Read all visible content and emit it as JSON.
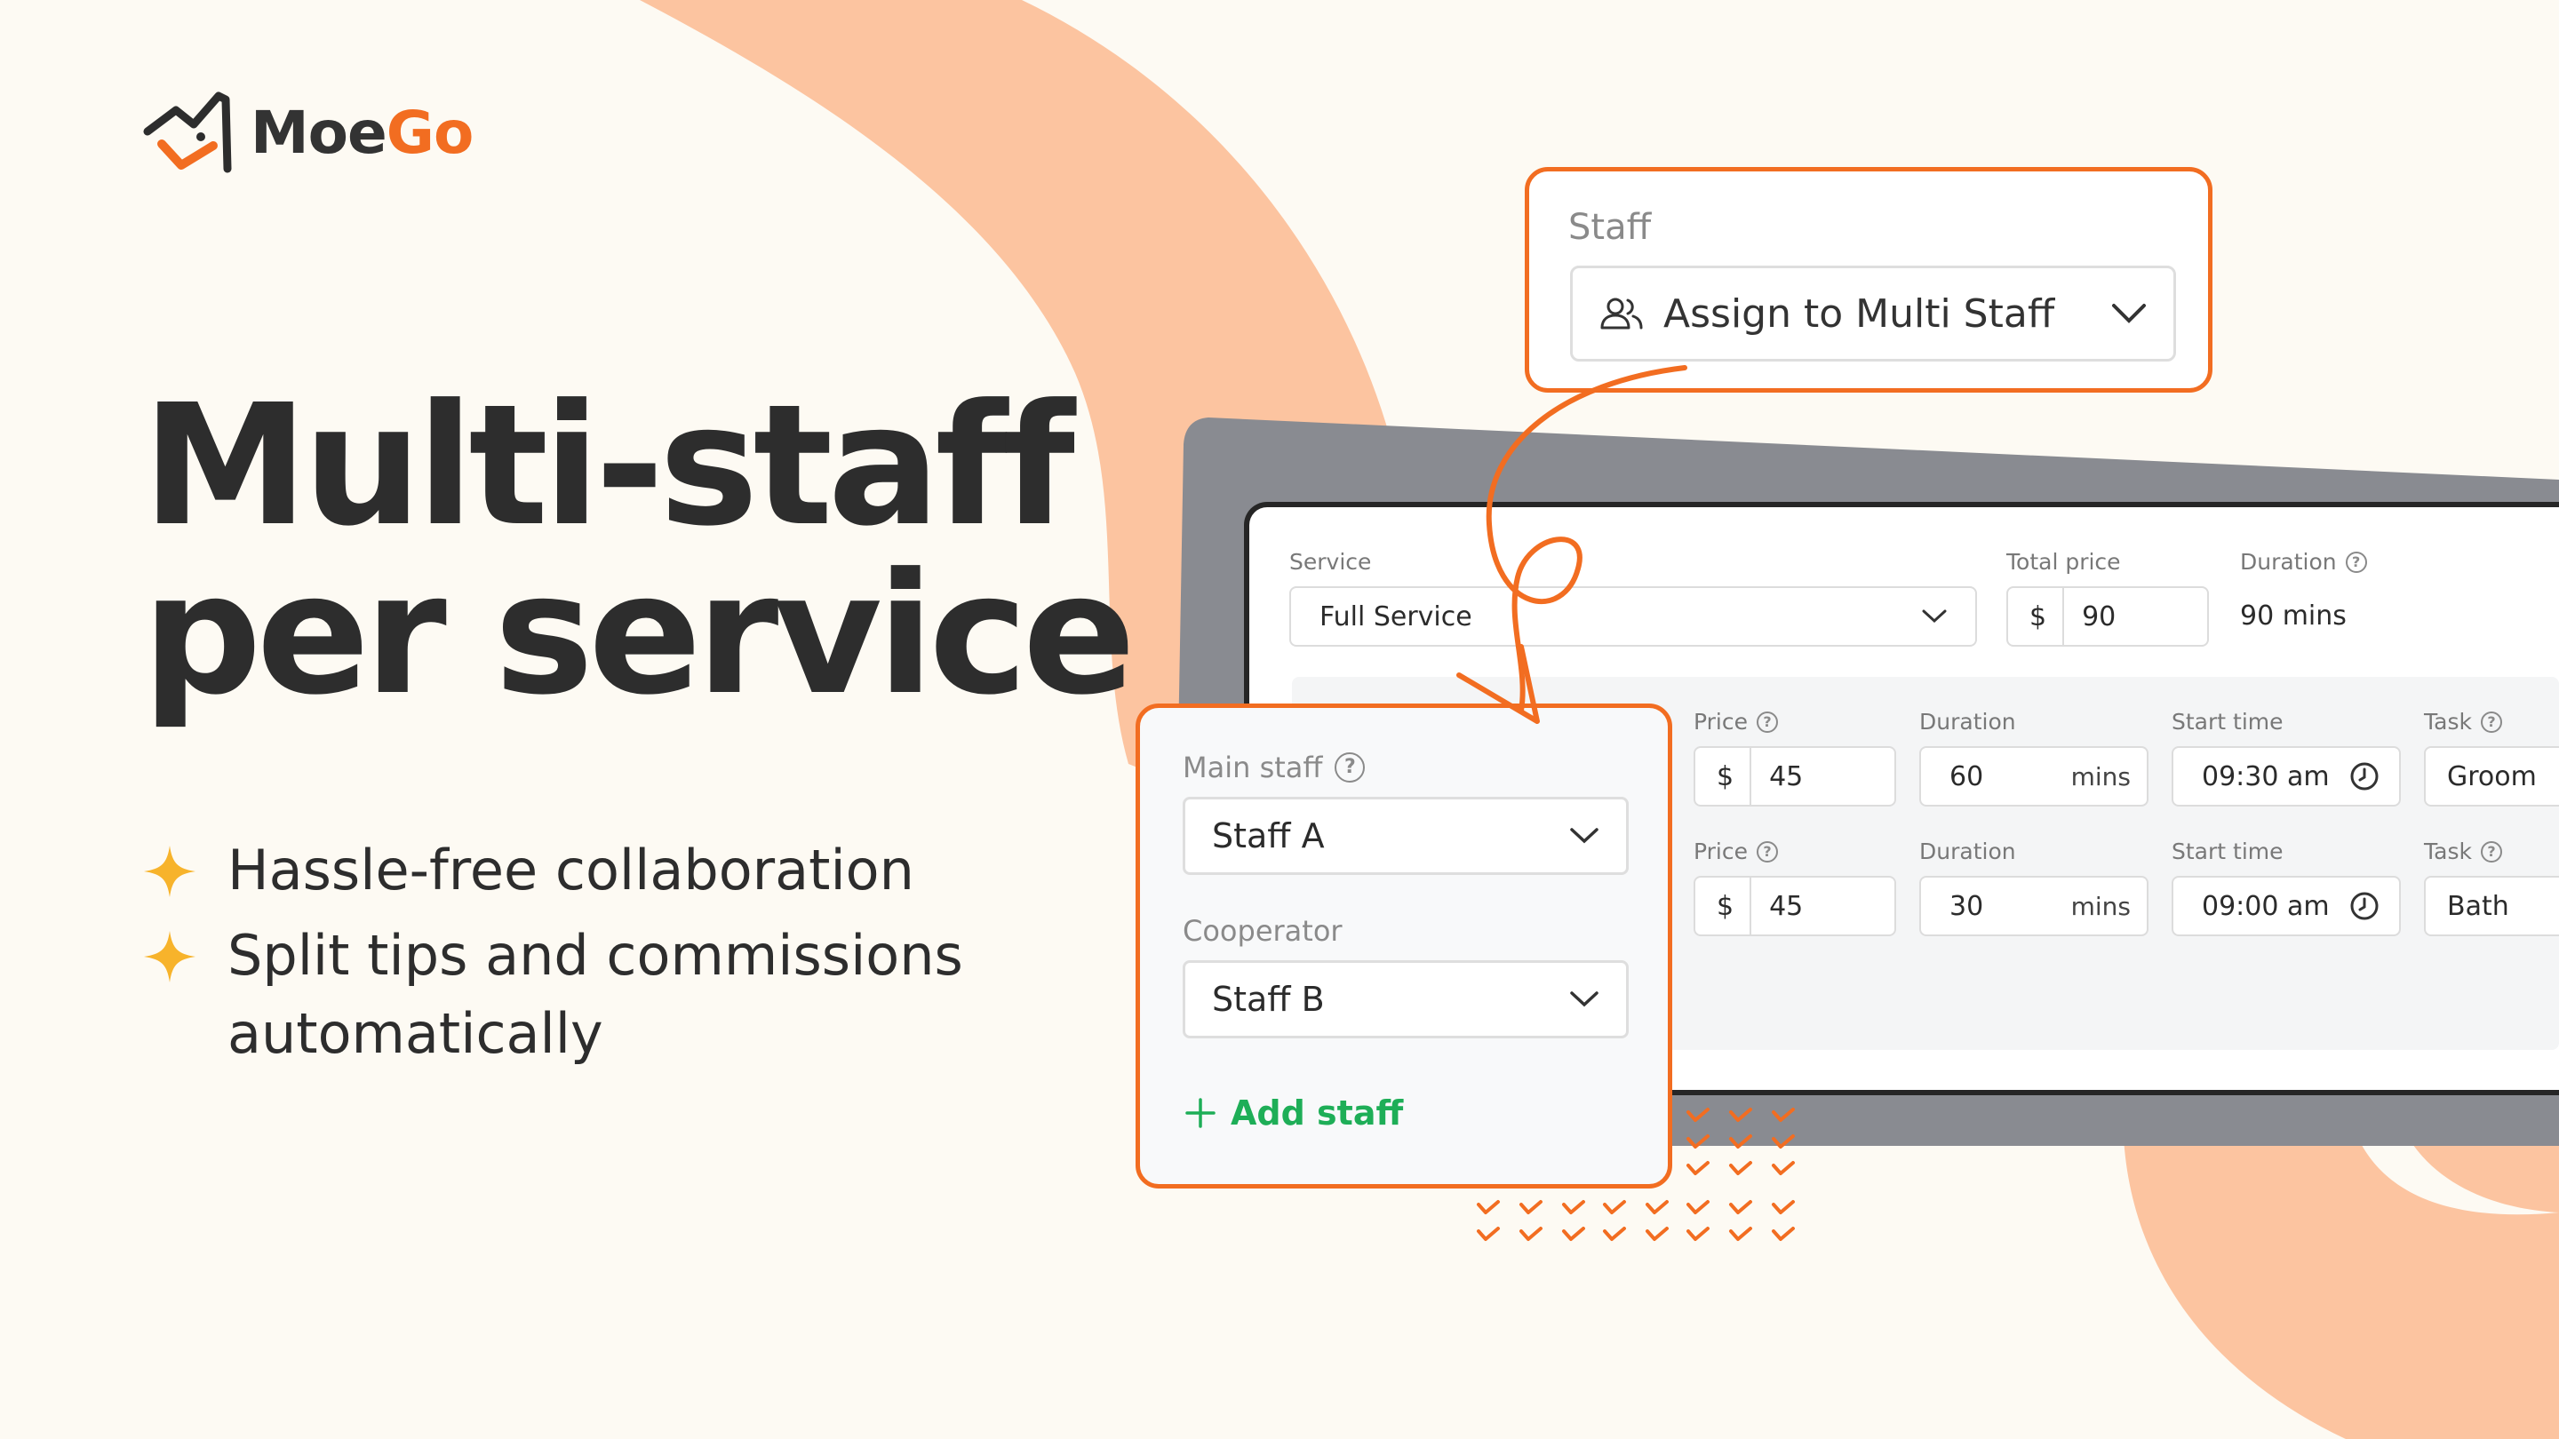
{
  "brand": {
    "name_part1": "Moe",
    "name_part2": "Go",
    "orange": "#f26d21",
    "peach": "#fcc4a0",
    "background": "#fdfaf3",
    "green": "#1eae57"
  },
  "headline": {
    "line1": "Multi-staff",
    "line2": "per service"
  },
  "bullets": [
    {
      "text": "Hassle-free collaboration",
      "icon": "sparkle-icon"
    },
    {
      "text": "Split tips and commissions automatically",
      "icon": "sparkle-icon"
    }
  ],
  "staff_popup": {
    "title": "Staff",
    "selected": "Assign to Multi Staff",
    "icon": "users-icon"
  },
  "service_panel": {
    "service_label": "Service",
    "service_value": "Full Service",
    "total_price_label": "Total price",
    "total_price_currency": "$",
    "total_price_value": "90",
    "duration_label": "Duration",
    "duration_value": "90 mins",
    "rows": [
      {
        "price_label": "Price",
        "currency": "$",
        "price": "45",
        "duration_label": "Duration",
        "duration": "60",
        "duration_unit": "mins",
        "start_label": "Start time",
        "start": "09:30 am",
        "task_label": "Task",
        "task": "Groom"
      },
      {
        "price_label": "Price",
        "currency": "$",
        "price": "45",
        "duration_label": "Duration",
        "duration": "30",
        "duration_unit": "mins",
        "start_label": "Start time",
        "start": "09:00 am",
        "task_label": "Task",
        "task": "Bath"
      }
    ]
  },
  "staff_assign": {
    "main_label": "Main staff",
    "main_value": "Staff A",
    "coop_label": "Cooperator",
    "coop_value": "Staff B",
    "add_label": "Add staff"
  }
}
